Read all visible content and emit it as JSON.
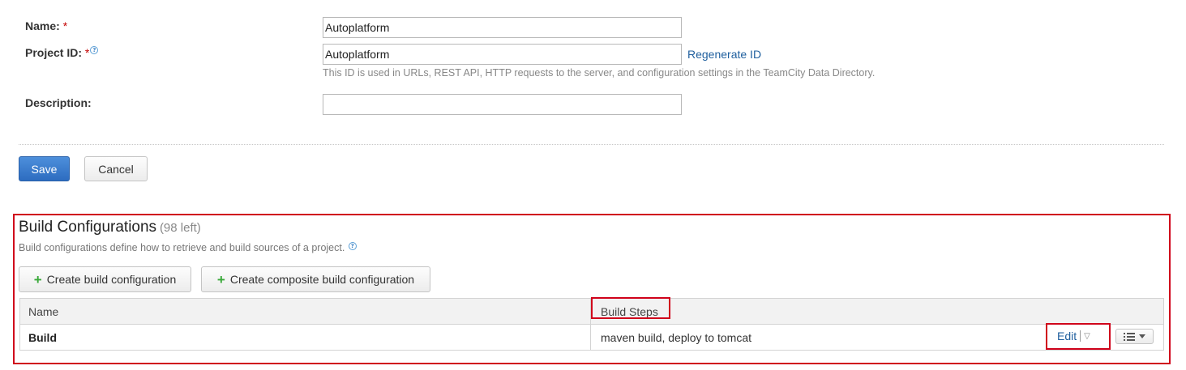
{
  "form": {
    "name_label": "Name:",
    "name_required": "*",
    "name_value": "Autoplatform",
    "project_id_label": "Project ID:",
    "project_id_required": "*",
    "project_id_value": "Autoplatform",
    "regenerate_link": "Regenerate ID",
    "project_id_hint": "This ID is used in URLs, REST API, HTTP requests to the server, and configuration settings in the TeamCity Data Directory.",
    "description_label": "Description:",
    "description_value": "",
    "save_label": "Save",
    "cancel_label": "Cancel"
  },
  "build_configs": {
    "title": "Build Configurations",
    "count": "(98 left)",
    "description": "Build configurations define how to retrieve and build sources of a project.",
    "create_button": "Create build configuration",
    "create_composite_button": "Create composite build configuration",
    "columns": [
      "Name",
      "Build Steps"
    ],
    "rows": [
      {
        "name": "Build",
        "steps": "maven build, deploy to tomcat",
        "edit_label": "Edit"
      }
    ]
  },
  "icons": {
    "help": "help-icon",
    "plus": "plus-icon",
    "dropdown": "triangle-down-icon",
    "list_menu": "list-menu-icon"
  },
  "colors": {
    "primary_button": "#2d6cc0",
    "link": "#1f5f9e",
    "highlight_border": "#d0021b",
    "required": "#c30000",
    "plus_icon": "#3aa93a"
  }
}
